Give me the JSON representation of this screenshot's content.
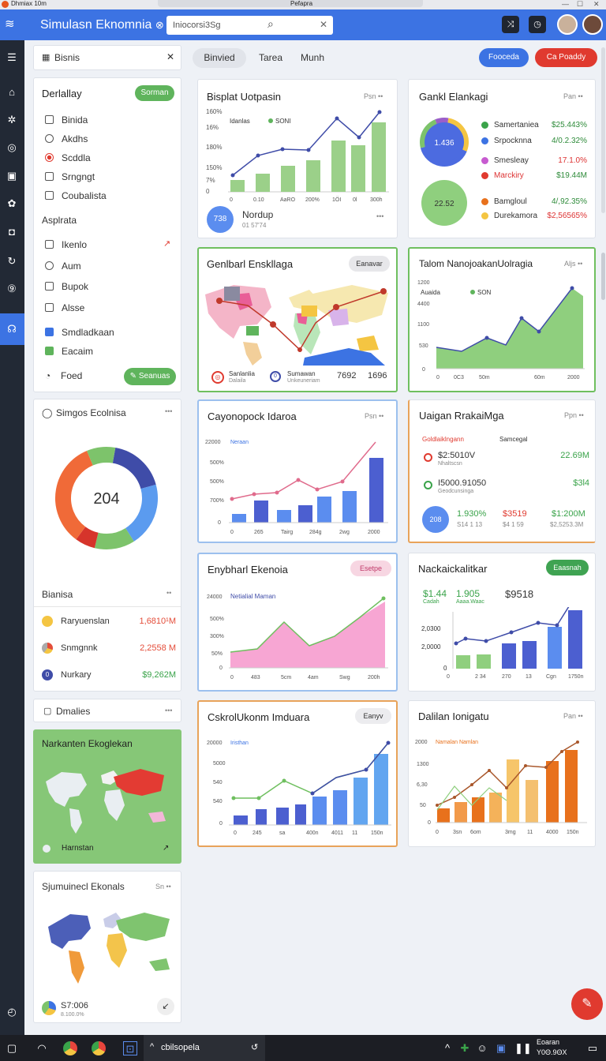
{
  "window": {
    "title": "Dhmiax 10m",
    "center": "Pefapra"
  },
  "header": {
    "app_title": "Simulasn Eknomnia",
    "app_title_icon": "link-icon",
    "search_value": "Iniocorsi3Sg"
  },
  "tabs": [
    {
      "label": "Binvied"
    },
    {
      "label": "Tarea"
    },
    {
      "label": "Munh"
    }
  ],
  "actions": {
    "primary": "Fooceda",
    "danger": "Ca Poaddy"
  },
  "filter_panel": {
    "tab": "Bisnis",
    "section1": {
      "title": "Derlallay",
      "button": "Sorman",
      "items": [
        "Binida",
        "Akdhs",
        "Scddla",
        "Srngngt",
        "Coubalista"
      ]
    },
    "section2": {
      "title": "Asplrata",
      "items": [
        "Ikenlo",
        "Aum",
        "Bupok",
        "Alsse",
        "Smdladkaan",
        "Eacaim"
      ]
    },
    "footer_label": "Foed",
    "footer_button": "Seanuas"
  },
  "donut_panel": {
    "title": "Simgos Ecolnisa",
    "center_value": "204",
    "list_title": "Bianisa",
    "rows": [
      {
        "name": "Raryuenslan",
        "value": "1,6810¹M",
        "color": "#e44d3a"
      },
      {
        "name": "Snmgnnk",
        "value": "2,2558 M",
        "color": "#e44d3a"
      },
      {
        "name": "Nurkary",
        "value": "$9,262M",
        "color": "#3aa34a"
      }
    ]
  },
  "dmalies_panel": {
    "title": "Dmalies",
    "map_title": "Narkanten Ekoglekan",
    "map_footer": "Harnstan"
  },
  "sjum_panel": {
    "title": "Sjumuinecl Ekonals",
    "corner": "Sn",
    "value": "S7:006",
    "sub": "8.100.0%"
  },
  "card1": {
    "title": "Bisplat Uotpasin",
    "corner": "Psn",
    "legend1": "Idanlas",
    "legend2": "SONI",
    "badge": "738",
    "foot_title": "Nordup",
    "foot_sub": "01 57'74",
    "yticks": [
      "160%",
      "16%",
      "180%",
      "150%",
      "7%",
      "0"
    ],
    "xticks": [
      "0",
      "0.10",
      "AaRO",
      "200%",
      "1ÖI",
      "0l",
      "300h"
    ]
  },
  "card2": {
    "title": "Gankl Elankagi",
    "corner": "Pan",
    "donut1": "1.436",
    "donut2": "22.52",
    "rows": [
      {
        "name": "Samertaniea",
        "value": "$25.443%",
        "color": "#2e8b3a"
      },
      {
        "name": "Srpocknna",
        "value": "4/0.2.32%",
        "color": "#2e8b3a"
      },
      {
        "name": "Smesleay",
        "value": "17.1.0%",
        "color": "#d33"
      },
      {
        "name": "Marckiry",
        "value": "$19.44M",
        "color": "#2e8b3a"
      },
      {
        "name": "Bamgloul",
        "value": "4/,92.35%",
        "color": "#2e8b3a"
      },
      {
        "name": "Durekamora",
        "value": "$2,56565%",
        "color": "#d33"
      }
    ]
  },
  "card3": {
    "title": "Genlbarl Enskllaga",
    "button": "Eanavar",
    "foot1": "Sanlanlia",
    "foot1b": "Dalaila",
    "foot2": "Sumawan",
    "foot2b": "Unkeuneriam",
    "val1": "7692",
    "val2": "1696"
  },
  "card4": {
    "title": "Talom NanojoakanUolragia",
    "corner": "Aljs",
    "legend1": "Auaida",
    "legend2": "SON",
    "yticks": [
      "1200",
      "4400",
      "1100",
      "530",
      "0"
    ],
    "xticks": [
      "0",
      "0C3",
      "50m",
      "60m",
      "2000"
    ]
  },
  "card5": {
    "title": "Cayonopock Idaroa",
    "corner": "Psn",
    "label": "Neraan",
    "yticks": [
      "22000",
      "500%",
      "500%",
      "700%",
      "0"
    ],
    "xticks": [
      "0",
      "265",
      "Tairg",
      "284g",
      "2wg",
      "2000"
    ]
  },
  "card6": {
    "title": "Uaigan RrakaiMga",
    "corner": "Ppn",
    "left_head": "Goldlaiklngann",
    "right_head": "Samcegal",
    "r1": "$2:5010V",
    "r1s": "Nhaltscsn",
    "r1v": "22.69M",
    "r2": "I5000.91050",
    "r2s": "Geodcunsinga",
    "r2v": "$3l4",
    "badge": "208",
    "s1": "1.930%",
    "s1b": "S14 1 13",
    "s2": "$3519",
    "s2b": "$4 1 59",
    "s3": "$1:200M",
    "s3b": "$2,5253.3M"
  },
  "card7": {
    "title": "Enybharl Ekenoia",
    "button": "Esetpe",
    "label": "Netialial Maman",
    "yticks": [
      "24000",
      "500%",
      "300%",
      "50%",
      "0"
    ],
    "xticks": [
      "0",
      "483",
      "5cm",
      "4am",
      "Swg",
      "200h"
    ]
  },
  "card8": {
    "title": "Nackaickalitkar",
    "button": "Eaasnah",
    "stat1": "$1.44",
    "stat1s": "Cadah",
    "stat2": "1.905",
    "stat2s": "Aaaa.Waac",
    "stat3": "$9518",
    "yticks": [
      "2,0300",
      "2,0000",
      "0"
    ],
    "xticks": [
      "0",
      "2 34",
      "270",
      "13",
      "Cgn",
      "1750n"
    ]
  },
  "card9": {
    "title": "CskrolUkonm Imduara",
    "button": "Eanyv",
    "label": "Iristhan",
    "yticks": [
      "20000",
      "5000",
      "540",
      "540",
      "0"
    ],
    "xticks": [
      "0",
      "245",
      "sa",
      "400n",
      "4011",
      "11",
      "150n"
    ]
  },
  "card10": {
    "title": "Dalilan Ionigatu",
    "corner": "Pan",
    "label": "Namalan Namlan",
    "yticks": [
      "2000",
      "1300",
      "6,30",
      "50",
      "0"
    ],
    "xticks": [
      "0",
      "3sn",
      "6om",
      "3mg",
      "11",
      "4000",
      "150n"
    ]
  },
  "taskbar": {
    "task_label": "cbilsopela",
    "clock": "Eoaran",
    "date": "Y0Θ.9ΘX"
  }
}
